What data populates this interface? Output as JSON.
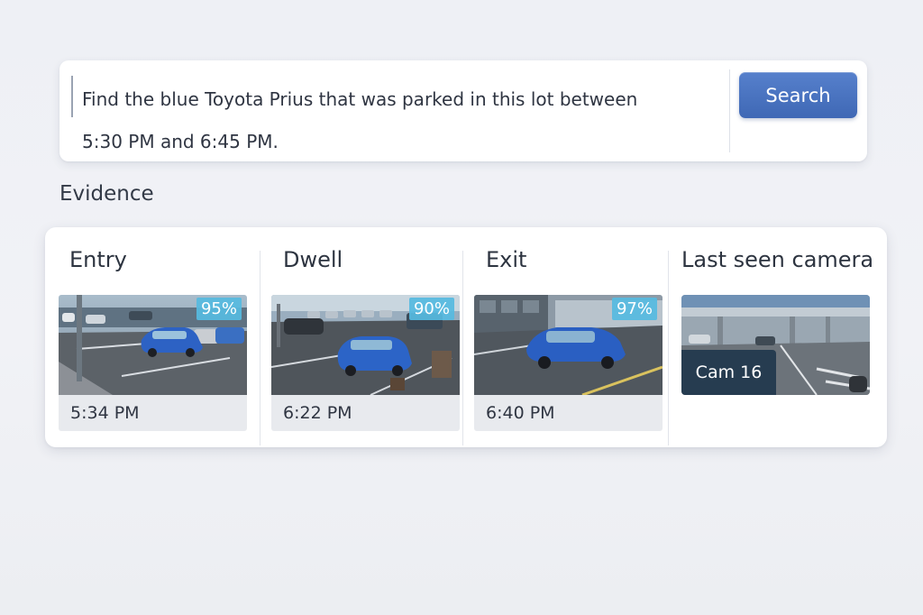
{
  "search": {
    "query": "Find the blue Toyota Prius that was parked in this lot between\n5:30 PM and 6:45 PM.",
    "button_label": "Search",
    "button_color": "#4a74c1"
  },
  "evidence": {
    "heading": "Evidence",
    "stages": [
      {
        "title": "Entry",
        "confidence": "95%",
        "time": "5:34 PM"
      },
      {
        "title": "Dwell",
        "confidence": "90%",
        "time": "6:22 PM"
      },
      {
        "title": "Exit",
        "confidence": "97%",
        "time": "6:40 PM"
      }
    ],
    "last_seen": {
      "title": "Last seen camera",
      "camera": "Cam 16"
    },
    "badge_color": "#56bae0"
  }
}
